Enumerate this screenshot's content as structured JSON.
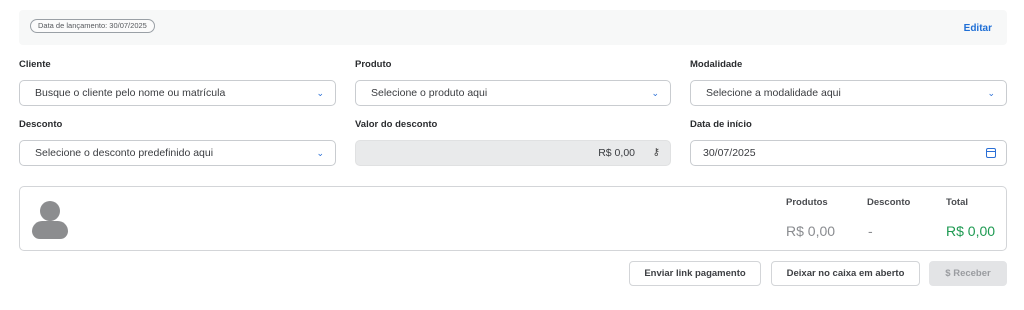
{
  "header": {
    "date_label": "Data de lançamento: 30/07/2025",
    "edit_label": "Editar"
  },
  "form": {
    "cliente": {
      "label": "Cliente",
      "placeholder": "Busque o cliente pelo nome ou matrícula"
    },
    "produto": {
      "label": "Produto",
      "placeholder": "Selecione o produto aqui"
    },
    "modalidade": {
      "label": "Modalidade",
      "placeholder": "Selecione a modalidade aqui"
    },
    "desconto": {
      "label": "Desconto",
      "placeholder": "Selecione o desconto predefinido aqui"
    },
    "valor_desconto": {
      "label": "Valor do desconto",
      "value": "R$ 0,00"
    },
    "data_inicio": {
      "label": "Data de início",
      "value": "30/07/2025"
    }
  },
  "summary": {
    "produtos_label": "Produtos",
    "produtos_value": "R$ 0,00",
    "desconto_label": "Desconto",
    "desconto_value": "-",
    "total_label": "Total",
    "total_value": "R$ 0,00"
  },
  "actions": {
    "link_label": "Enviar link pagamento",
    "caixa_label": "Deixar no caixa em aberto",
    "receber_label": "$  Receber"
  },
  "icons": {
    "dropdown": "chevron-down-icon",
    "key": "key-icon",
    "calendar": "calendar-icon",
    "avatar": "user-avatar-icon"
  },
  "colors": {
    "accent": "#2a6fd6",
    "total": "#1e9a52"
  }
}
